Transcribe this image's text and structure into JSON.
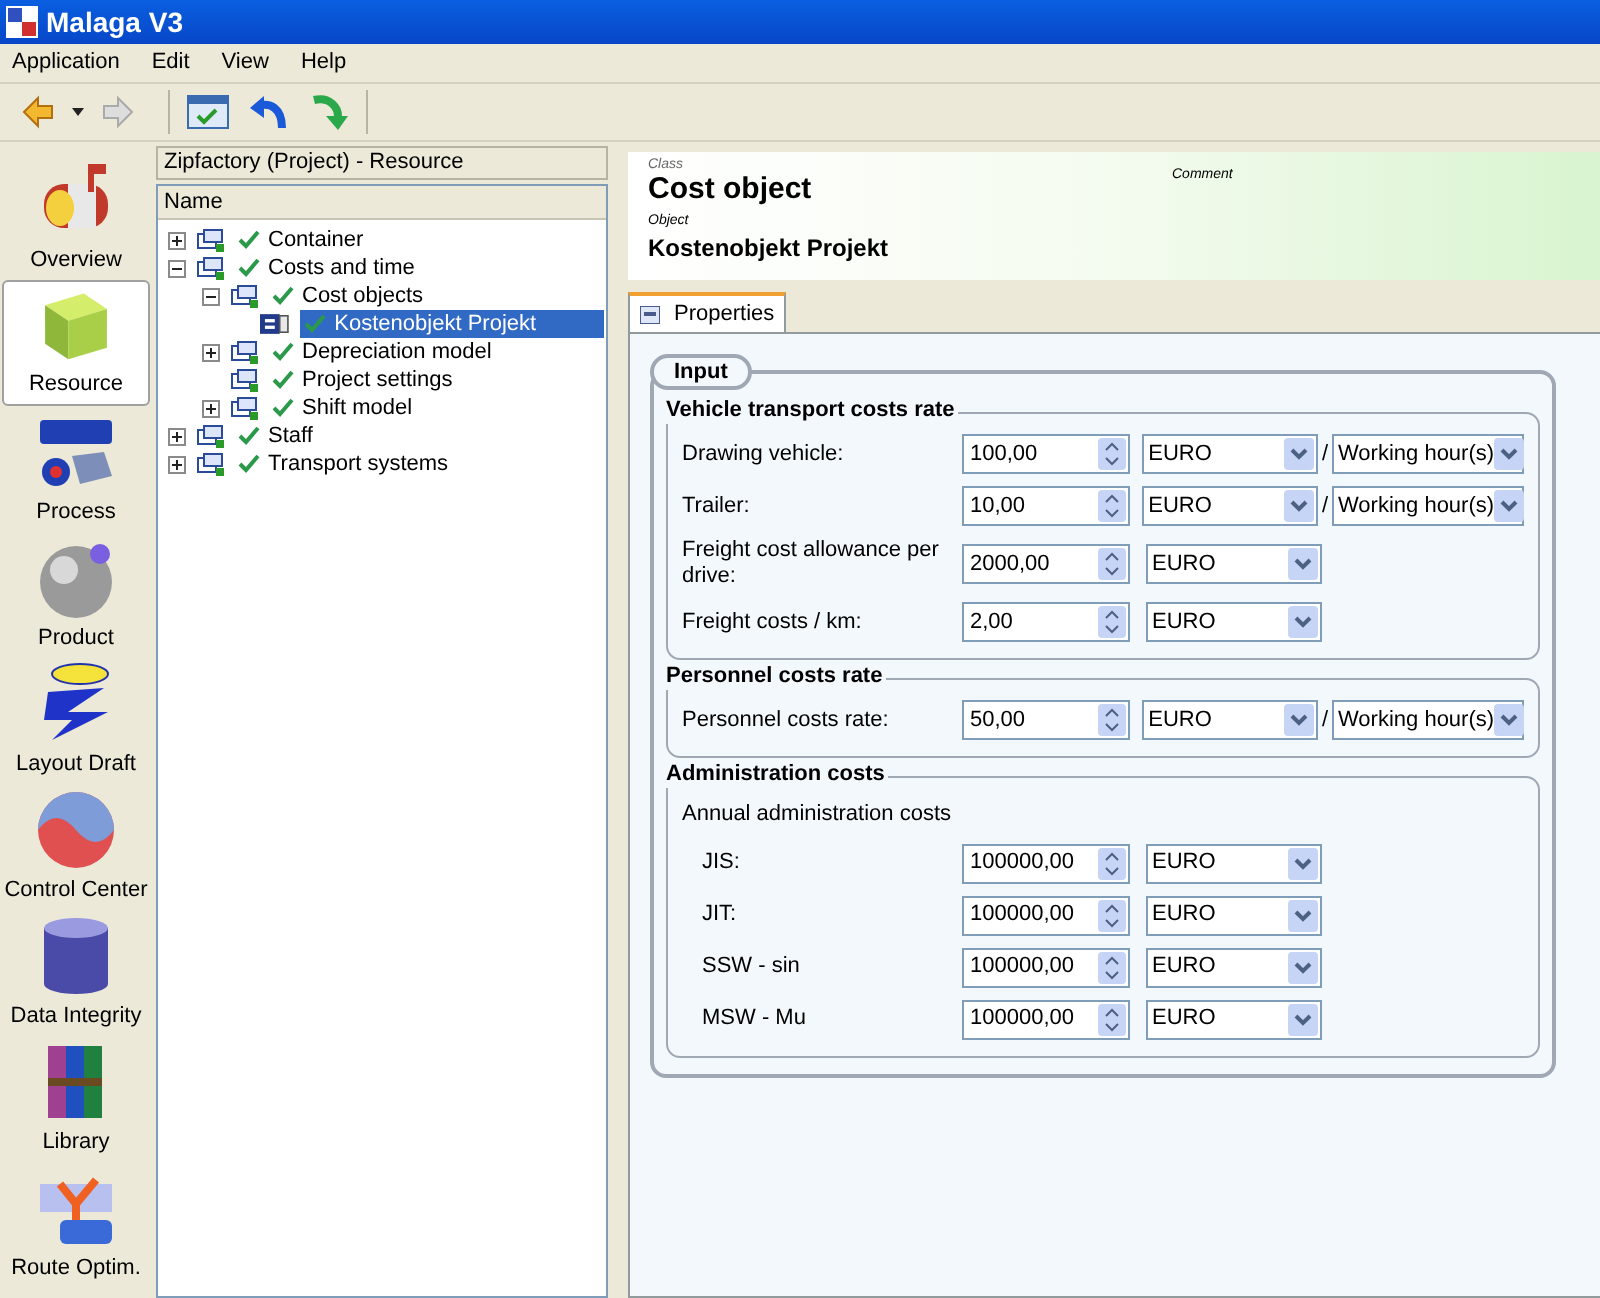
{
  "window": {
    "title": "Malaga V3"
  },
  "menu": [
    "Application",
    "Edit",
    "View",
    "Help"
  ],
  "nav": [
    {
      "label": "Overview",
      "selected": false
    },
    {
      "label": "Resource",
      "selected": true
    },
    {
      "label": "Process",
      "selected": false
    },
    {
      "label": "Product",
      "selected": false
    },
    {
      "label": "Layout Draft",
      "selected": false
    },
    {
      "label": "Control Center",
      "selected": false
    },
    {
      "label": "Data Integrity",
      "selected": false
    },
    {
      "label": "Library",
      "selected": false
    },
    {
      "label": "Route Optim.",
      "selected": false
    }
  ],
  "tree_panel": {
    "title": "Zipfactory (Project) - Resource",
    "column": "Name"
  },
  "tree": [
    {
      "label": "Container",
      "kind": "branch",
      "expanded": false,
      "selected": false
    },
    {
      "label": "Costs and time",
      "kind": "branch",
      "expanded": true,
      "selected": false,
      "children": [
        {
          "label": "Cost objects",
          "kind": "branch",
          "expanded": true,
          "selected": false,
          "children": [
            {
              "label": "Kostenobjekt Projekt",
              "kind": "object",
              "selected": true
            }
          ]
        },
        {
          "label": "Depreciation model",
          "kind": "branch",
          "expanded": false,
          "selected": false
        },
        {
          "label": "Project settings",
          "kind": "leaf",
          "selected": false
        },
        {
          "label": "Shift model",
          "kind": "branch",
          "expanded": false,
          "selected": false
        }
      ]
    },
    {
      "label": "Staff",
      "kind": "branch",
      "expanded": false,
      "selected": false
    },
    {
      "label": "Transport systems",
      "kind": "branch",
      "expanded": false,
      "selected": false
    }
  ],
  "header": {
    "class_caption": "Class",
    "class": "Cost object",
    "object_caption": "Object",
    "object": "Kostenobjekt Projekt",
    "comment_caption": "Comment"
  },
  "tabs": [
    {
      "label": "Properties",
      "selected": true
    }
  ],
  "form": {
    "title": "Input",
    "groups": [
      {
        "title": "Vehicle transport costs rate",
        "rows": [
          {
            "label": "Drawing vehicle:",
            "value": "100,00",
            "currency": "EURO",
            "separator": "/",
            "unit": "Working hour(s)"
          },
          {
            "label": "Trailer:",
            "value": "10,00",
            "currency": "EURO",
            "separator": "/",
            "unit": "Working hour(s)"
          },
          {
            "label": "Freight cost allowance per drive:",
            "value": "2000,00",
            "currency": "EURO"
          },
          {
            "label": "Freight costs / km:",
            "value": "2,00",
            "currency": "EURO"
          }
        ]
      },
      {
        "title": "Personnel costs rate",
        "rows": [
          {
            "label": "Personnel costs rate:",
            "value": "50,00",
            "currency": "EURO",
            "separator": "/",
            "unit": "Working hour(s)"
          }
        ]
      },
      {
        "title": "Administration costs",
        "subtitle": "Annual administration costs",
        "rows": [
          {
            "label": "JIS:",
            "value": "100000,00",
            "currency": "EURO"
          },
          {
            "label": "JIT:",
            "value": "100000,00",
            "currency": "EURO"
          },
          {
            "label": "SSW - sin",
            "value": "100000,00",
            "currency": "EURO"
          },
          {
            "label": "MSW - Mu",
            "value": "100000,00",
            "currency": "EURO"
          }
        ]
      }
    ]
  }
}
